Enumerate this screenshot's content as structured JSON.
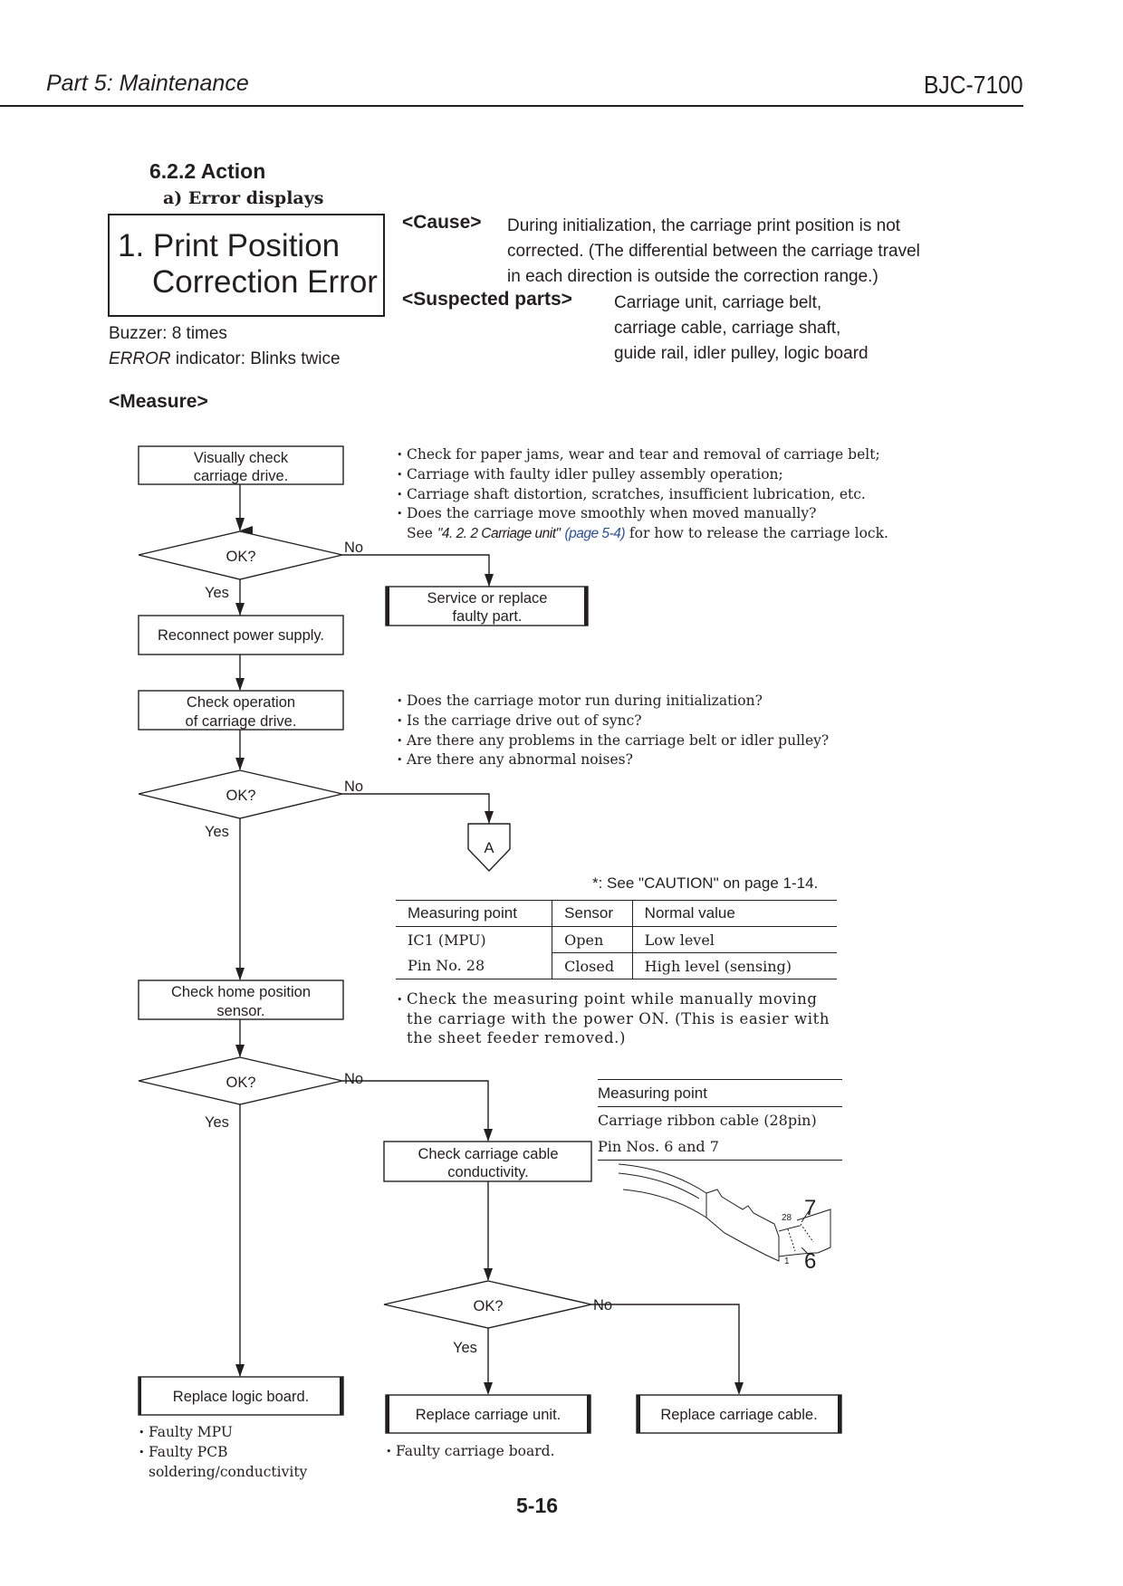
{
  "header": {
    "section": "Part 5: Maintenance",
    "model": "BJC-7100"
  },
  "section_title": "6.2.2 Action",
  "subsection_title": "a) Error displays",
  "error": {
    "line1": "1. Print Position",
    "line2": "Correction Error",
    "buzzer": "Buzzer: 8 times",
    "indicator_label": "ERROR",
    "indicator_text": " indicator: Blinks twice"
  },
  "cause": {
    "label": "<Cause>",
    "lines": [
      "During initialization, the carriage print position is not",
      "corrected. (The differential between the carriage travel",
      "in each direction is outside the correction range.)"
    ]
  },
  "suspected_parts": {
    "label": "<Suspected parts>",
    "lines": [
      "Carriage unit, carriage belt,",
      "carriage cable, carriage shaft,",
      "guide rail, idler pulley, logic board"
    ]
  },
  "measure_label": "<Measure>",
  "notes_visual_check": [
    "Check for paper jams, wear and tear and removal of carriage belt;",
    "Carriage with faulty idler pulley assembly operation;",
    "Carriage shaft distortion, scratches, insufficient lubrication, etc.",
    "Does the carriage move smoothly when moved manually?"
  ],
  "notes_visual_check_ref": {
    "prefix": "See ",
    "ref": "\"4. 2. 2 Carriage unit\"",
    "link": "(page 5-4)",
    "suffix": " for how to release the carriage lock.",
    "link_color": "#2b4fa0"
  },
  "notes_operation": [
    "Does the carriage motor run during initialization?",
    "Is the carriage drive out of sync?",
    "Are there any problems in the carriage belt or idler pulley?",
    "Are there any abnormal noises?"
  ],
  "caution_note": "*: See \"CAUTION\" on page 1-14.",
  "sensor_table": {
    "headers": [
      "Measuring point",
      "Sensor",
      "Normal value"
    ],
    "measuring_point_lines": [
      "IC1 (MPU)",
      "Pin No. 28"
    ],
    "rows": [
      {
        "sensor": "Open",
        "normal": "Low level"
      },
      {
        "sensor": "Closed",
        "normal": "High level (sensing)"
      }
    ]
  },
  "notes_home_sensor": "Check the measuring point while manually moving the carriage with the power ON. (This is easier with the sheet feeder removed.)",
  "cable_table": {
    "header": "Measuring point",
    "lines": [
      "Carriage ribbon cable (28pin)",
      "Pin Nos. 6 and 7"
    ]
  },
  "cable_figure": {
    "pin_high": "28",
    "pin_low": "1",
    "callout_7": "7",
    "callout_6": "6"
  },
  "flowchart": {
    "steps": {
      "visual_check": [
        "Visually check",
        "carriage drive."
      ],
      "service_replace": [
        "Service or replace",
        "faulty part."
      ],
      "reconnect": [
        "Reconnect power supply."
      ],
      "check_operation": [
        "Check operation",
        "of carriage drive."
      ],
      "connector_a": "A",
      "check_home": [
        "Check home position",
        "sensor."
      ],
      "check_cable": [
        "Check carriage cable",
        "conductivity."
      ],
      "replace_logic": [
        "Replace logic board."
      ],
      "replace_unit": [
        "Replace carriage unit."
      ],
      "replace_cable": [
        "Replace carriage cable."
      ]
    },
    "decision_label": "OK?",
    "yes_label": "Yes",
    "no_label": "No"
  },
  "notes_logic_board": [
    "Faulty MPU",
    "Faulty PCB soldering/conductivity"
  ],
  "notes_logic_board_lines": [
    "Faulty MPU",
    "Faulty PCB",
    "soldering/conductivity"
  ],
  "notes_carriage_unit": [
    "Faulty carriage board."
  ],
  "page_number": "5-16"
}
